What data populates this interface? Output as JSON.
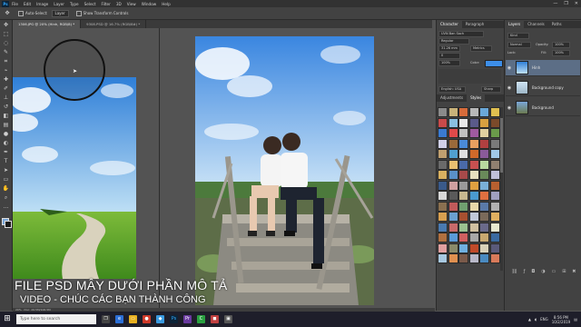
{
  "menubar": {
    "logo": "Ps",
    "items": [
      "File",
      "Edit",
      "Image",
      "Layer",
      "Type",
      "Select",
      "Filter",
      "3D",
      "View",
      "Window",
      "Help"
    ],
    "window_controls": [
      "—",
      "❐",
      "✕"
    ]
  },
  "options_bar": {
    "auto_select_label": "Auto-Select:",
    "auto_select_value": "Layer",
    "transform_label": "Show Transform Controls"
  },
  "tabs": [
    {
      "label": "1306.JPG @ 20% (Hinh, RGB/8) *",
      "active": true
    },
    {
      "label": "9308.PSD @ 16.7% (RGB/8#) *",
      "active": false
    }
  ],
  "captions": {
    "line1": "FILE PSD MÂY DƯỚI PHẦN MÔ TẢ",
    "line2": "VIDEO - CHÚC CÁC BẠN THÀNH CÔNG"
  },
  "character_panel": {
    "tabs": [
      "Character",
      "Paragraph"
    ],
    "font": "UVN Ban Sach",
    "style": "Regular",
    "size": "31.26 mm",
    "leading": "Metrics",
    "tracking": "0",
    "scale": "100%",
    "color_label": "Color:",
    "language": "English: USA",
    "antialias": "Sharp"
  },
  "styles_panel": {
    "tabs": [
      "Adjustments",
      "Styles"
    ],
    "swatch_colors": [
      "#8a8a8a",
      "#c9b37a",
      "#d66b3a",
      "#b8b8b8",
      "#6aa8d8",
      "#e0c050",
      "#c74a4a",
      "#8ac0e0",
      "#e8e8e8",
      "#5a5a8a",
      "#d8a040",
      "#7a4a2a",
      "#3a7ad0",
      "#e04a4a",
      "#c0c0c0",
      "#a05aa0",
      "#e0d0a0",
      "#6a9a4a",
      "#d0d0e8",
      "#9a6a3a",
      "#4a8ad8",
      "#e8a060",
      "#b04040",
      "#7a7a7a",
      "#c0a070",
      "#50a0d0",
      "#e0e0e0",
      "#d06a2a",
      "#8a5a9a",
      "#a0c8e8",
      "#6a6a6a",
      "#e8c070",
      "#4a6aa8",
      "#c85050",
      "#b8d8a0",
      "#908070",
      "#d8b060",
      "#5a90c8",
      "#a84a4a",
      "#e8e0c0",
      "#6a8a5a",
      "#c0c0d8",
      "#3a5a8a",
      "#d0a0a0",
      "#9a9a9a",
      "#e0a040",
      "#7ab0d8",
      "#b86030",
      "#d8d8d8",
      "#5a5a5a",
      "#c8b890",
      "#4a9ad0",
      "#e07040",
      "#a0a0c0",
      "#8a7050",
      "#c05a5a",
      "#70a070",
      "#e8d8a8",
      "#5a7aa8",
      "#b0b0b0",
      "#d8a050",
      "#6aa0d0",
      "#a85030",
      "#c0c8d8",
      "#7a6a5a",
      "#e0b060",
      "#4a7ab0",
      "#c86a6a",
      "#9ac090",
      "#d0c0a0",
      "#6a6a8a",
      "#e8e8d0",
      "#b07040",
      "#5a9ad8",
      "#d06060",
      "#a8a8a8",
      "#c8a870",
      "#3a6aa0",
      "#e0a0a0",
      "#8a8a6a",
      "#70b0e0",
      "#c04a2a",
      "#d8d0b8",
      "#5a5a7a",
      "#a8c8e0",
      "#e09050",
      "#7a5a4a",
      "#b8b8c8",
      "#4a8ac0",
      "#d87a5a"
    ]
  },
  "layers_panel": {
    "tabs": [
      "Layers",
      "Channels",
      "Paths"
    ],
    "kind": "Kind",
    "blend": "Normal",
    "opacity_label": "Opacity:",
    "opacity": "100%",
    "lock_label": "Lock:",
    "fill_label": "Fill:",
    "fill": "100%",
    "layers": [
      {
        "name": "Hinh",
        "selected": true
      },
      {
        "name": "Background copy",
        "selected": false
      },
      {
        "name": "Background",
        "selected": false
      }
    ]
  },
  "statusbar": {
    "text": "20% · Doc: 26.5M/106.5M"
  },
  "taskbar": {
    "search_placeholder": "Type here to search",
    "time": "8:56 PM",
    "date": "10/2/2019",
    "lang": "ENG"
  }
}
